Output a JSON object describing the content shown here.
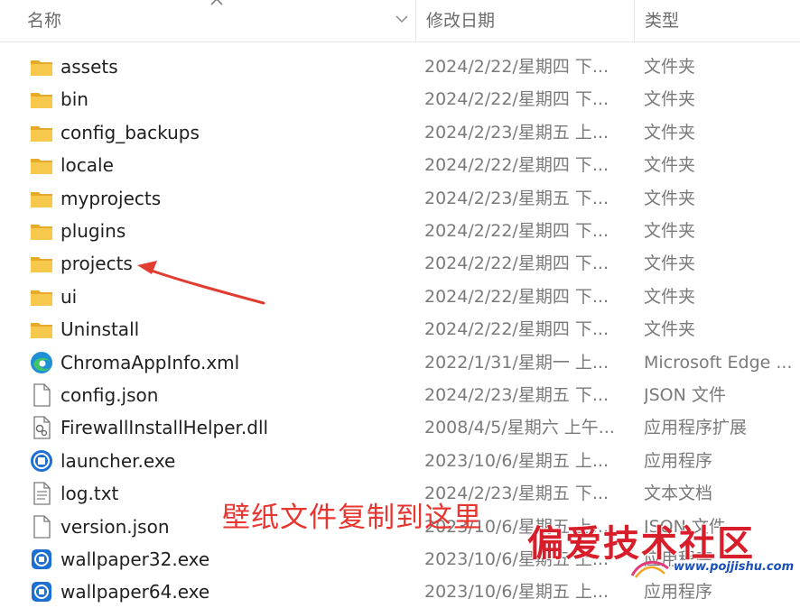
{
  "columns": {
    "name": "名称",
    "date": "修改日期",
    "type": "类型"
  },
  "files": [
    {
      "name": "assets",
      "date": "2024/2/22/星期四 下...",
      "type": "文件夹",
      "icon": "folder-icon"
    },
    {
      "name": "bin",
      "date": "2024/2/22/星期四 下...",
      "type": "文件夹",
      "icon": "folder-icon"
    },
    {
      "name": "config_backups",
      "date": "2024/2/23/星期五 上...",
      "type": "文件夹",
      "icon": "folder-icon"
    },
    {
      "name": "locale",
      "date": "2024/2/22/星期四 下...",
      "type": "文件夹",
      "icon": "folder-icon"
    },
    {
      "name": "myprojects",
      "date": "2024/2/23/星期五 下...",
      "type": "文件夹",
      "icon": "folder-icon"
    },
    {
      "name": "plugins",
      "date": "2024/2/22/星期四 下...",
      "type": "文件夹",
      "icon": "folder-icon"
    },
    {
      "name": "projects",
      "date": "2024/2/22/星期四 下...",
      "type": "文件夹",
      "icon": "folder-icon"
    },
    {
      "name": "ui",
      "date": "2024/2/22/星期四 下...",
      "type": "文件夹",
      "icon": "folder-icon"
    },
    {
      "name": "Uninstall",
      "date": "2024/2/22/星期四 下...",
      "type": "文件夹",
      "icon": "folder-icon"
    },
    {
      "name": "ChromaAppInfo.xml",
      "date": "2022/1/31/星期一 上...",
      "type": "Microsoft Edge ...",
      "icon": "edge-icon"
    },
    {
      "name": "config.json",
      "date": "2024/2/23/星期五 下...",
      "type": "JSON 文件",
      "icon": "document-icon"
    },
    {
      "name": "FirewallInstallHelper.dll",
      "date": "2008/4/5/星期六 上午...",
      "type": "应用程序扩展",
      "icon": "dll-icon"
    },
    {
      "name": "launcher.exe",
      "date": "2023/10/6/星期五 上...",
      "type": "应用程序",
      "icon": "launcher-icon"
    },
    {
      "name": "log.txt",
      "date": "2024/2/23/星期五 下...",
      "type": "文本文档",
      "icon": "text-file-icon"
    },
    {
      "name": "version.json",
      "date": "2023/10/6/星期五 上...",
      "type": "JSON 文件",
      "icon": "document-icon"
    },
    {
      "name": "wallpaper32.exe",
      "date": "2023/10/6/星期五 上...",
      "type": "应用程序",
      "icon": "wallpaper-app-icon"
    },
    {
      "name": "wallpaper64.exe",
      "date": "2023/10/6/星期五 上...",
      "type": "应用程序",
      "icon": "wallpaper-app-icon"
    }
  ],
  "annotation": {
    "text": "壁纸文件复制到这里",
    "color": "#e8352f"
  },
  "watermark": {
    "text": "偏爱技术社区",
    "url": "www.pojjishu.com",
    "color": "#d81e2a"
  },
  "colors": {
    "folder": "#f3c34a",
    "edge": "#1f8fd6",
    "app": "#1d6fd1"
  }
}
